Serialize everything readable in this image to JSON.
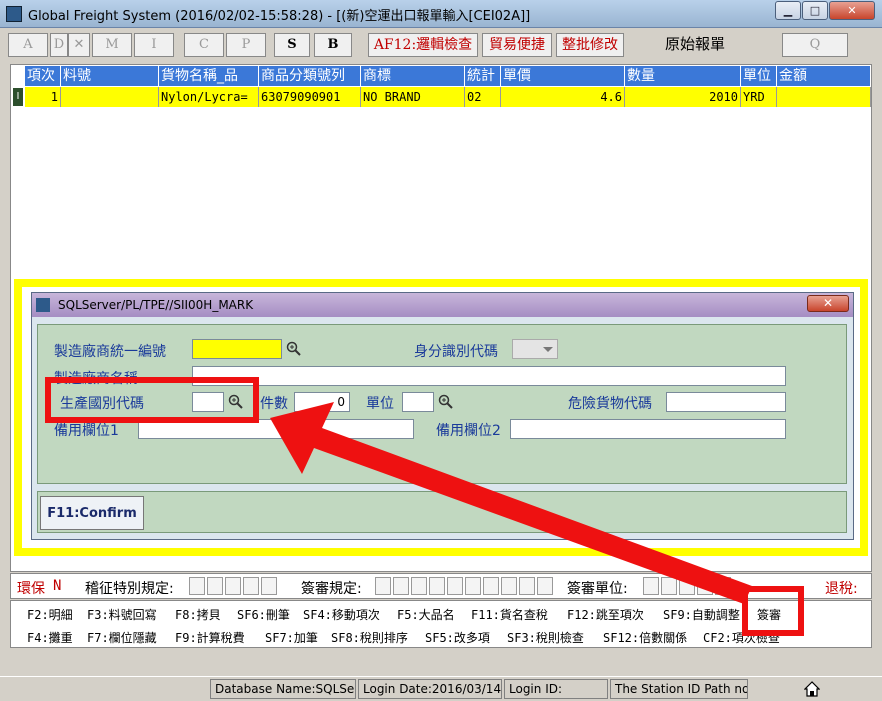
{
  "window": {
    "title": "Global Freight System (2016/02/02-15:58:28) - [(新)空運出口報單輸入[CEI02A]]",
    "min_label": "▁",
    "max_label": "□",
    "close_label": "✕"
  },
  "toolbar": {
    "a": "A",
    "d": "D",
    "x": "✕",
    "m": "M",
    "i": "I",
    "c": "C",
    "p": "P",
    "s": "S",
    "b": "B",
    "af12": "AF12:邏輯檢查",
    "trade": "貿易便捷",
    "whole": "整批修改",
    "orig": "原始報單",
    "q": "Q"
  },
  "grid": {
    "headers": [
      "項次",
      "料號",
      "貨物名稱_品",
      "商品分類號列",
      "商標",
      "統計",
      "單價",
      "數量",
      "單位",
      "金額"
    ],
    "row": {
      "indicator": "I",
      "item": "1",
      "part": "",
      "name": "Nylon/Lycra=",
      "code": "63079090901",
      "brand": "NO BRAND",
      "stat": "02",
      "price": "4.6",
      "qty": "2010",
      "unit": "YRD",
      "amount": ""
    }
  },
  "dialog": {
    "title": "SQLServer/PL/TPE//SII00H_MARK",
    "close": "✕",
    "mfr_id_label": "製造廠商統一編號",
    "id_type_label": "身分識別代碼",
    "mfr_name_label": "製造廠商名稱",
    "origin_label": "生產國別代碼",
    "pieces_label": "件數",
    "pieces_value": "0",
    "unit_label": "單位",
    "danger_label": "危險貨物代碼",
    "spare1_label": "備用欄位1",
    "spare2_label": "備用欄位2",
    "confirm_label": "F11:Confirm"
  },
  "bottom": {
    "eco": "環保",
    "eco_flag": "N",
    "levy": "稽征特別規定:",
    "sign_rule": "簽審規定:",
    "sign_unit": "簽審單位:",
    "refund": "退稅:"
  },
  "fkeys": {
    "row1": [
      "F2:明細",
      "F3:料號回寫",
      "F8:拷貝",
      "SF6:刪筆",
      "SF4:移動項次",
      "F5:大品名",
      "F11:貨名查稅",
      "F12:跳至項次",
      "SF9:自動調整",
      "簽審"
    ],
    "row2": [
      "F4:攤重",
      "F7:欄位隱藏",
      "F9:計算稅費",
      "SF7:加筆",
      "SF8:稅則排序",
      "SF5:改多項",
      "SF3:稅則檢查",
      "SF12:倍數關係",
      "CF2:項次檢查"
    ]
  },
  "status": {
    "db": "Database Name:SQLServer",
    "login_date": "Login Date:2016/03/14",
    "login_id": "Login ID:",
    "station": "The Station ID Path not S"
  },
  "colors": {
    "header": "#3b78d8",
    "row": "#ffff00",
    "annotation": "#ee1111",
    "frame": "#ffff00",
    "dialog_body": "#c1d8c0"
  }
}
